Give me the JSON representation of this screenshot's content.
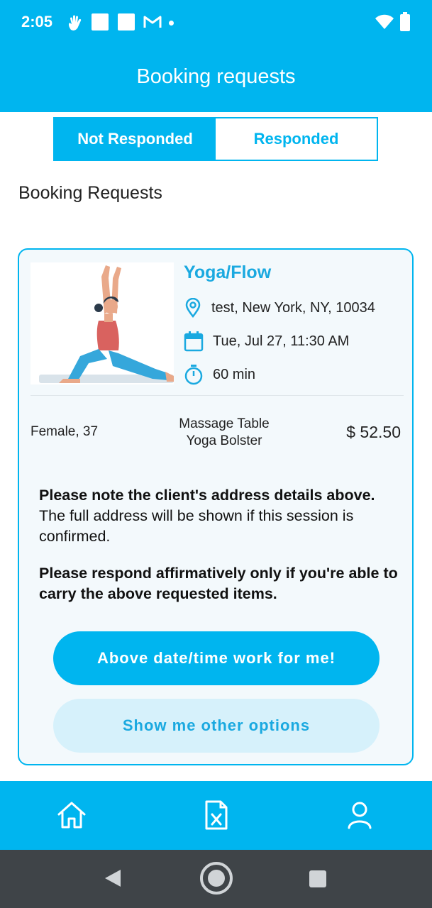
{
  "status_bar": {
    "time": "2:05",
    "icons": [
      "hand-icon",
      "notification-square-icon",
      "notification-square-icon",
      "gmail-icon",
      "dot-icon",
      "wifi-icon",
      "battery-icon"
    ]
  },
  "header": {
    "title": "Booking requests"
  },
  "tabs": [
    {
      "label": "Not Responded",
      "active": true
    },
    {
      "label": "Responded",
      "active": false
    }
  ],
  "section_title": "Booking Requests",
  "booking": {
    "service": "Yoga/Flow",
    "location": "test, New York, NY, 10034",
    "datetime": "Tue, Jul 27, 11:30 AM",
    "duration": "60 min",
    "client": "Female, 37",
    "items": [
      "Massage Table",
      "Yoga Bolster"
    ],
    "price": "$ 52.50",
    "note1_bold": "Please note the client's address details above.",
    "note1_rest": "The full address will be shown if this session is confirmed.",
    "note2_bold": "Please respond affirmatively only if you're able to carry the above requested items.",
    "accept_button": "Above date/time work for me!",
    "options_button": "Show me other options"
  },
  "bottom_nav": [
    "home-icon",
    "document-x-icon",
    "profile-icon"
  ],
  "system_nav": [
    "back-icon",
    "home-circle-icon",
    "recents-icon"
  ],
  "colors": {
    "accent": "#00B5EF",
    "accent_light": "#D6F1FB",
    "card_bg": "#F3F9FC",
    "system_nav": "#3F4448"
  }
}
